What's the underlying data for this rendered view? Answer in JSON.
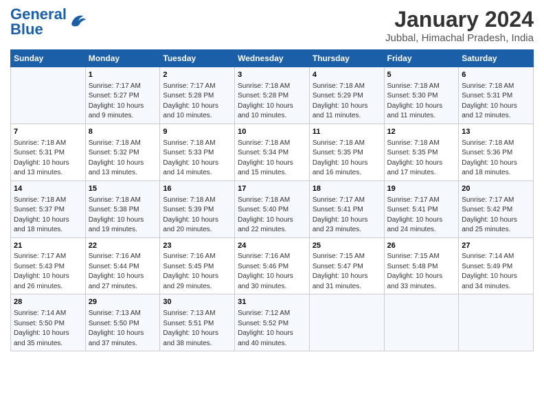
{
  "header": {
    "logo_general": "General",
    "logo_blue": "Blue",
    "month": "January 2024",
    "location": "Jubbal, Himachal Pradesh, India"
  },
  "weekdays": [
    "Sunday",
    "Monday",
    "Tuesday",
    "Wednesday",
    "Thursday",
    "Friday",
    "Saturday"
  ],
  "weeks": [
    [
      {
        "day": "",
        "sunrise": "",
        "sunset": "",
        "daylight": ""
      },
      {
        "day": "1",
        "sunrise": "Sunrise: 7:17 AM",
        "sunset": "Sunset: 5:27 PM",
        "daylight": "Daylight: 10 hours and 9 minutes."
      },
      {
        "day": "2",
        "sunrise": "Sunrise: 7:17 AM",
        "sunset": "Sunset: 5:28 PM",
        "daylight": "Daylight: 10 hours and 10 minutes."
      },
      {
        "day": "3",
        "sunrise": "Sunrise: 7:18 AM",
        "sunset": "Sunset: 5:28 PM",
        "daylight": "Daylight: 10 hours and 10 minutes."
      },
      {
        "day": "4",
        "sunrise": "Sunrise: 7:18 AM",
        "sunset": "Sunset: 5:29 PM",
        "daylight": "Daylight: 10 hours and 11 minutes."
      },
      {
        "day": "5",
        "sunrise": "Sunrise: 7:18 AM",
        "sunset": "Sunset: 5:30 PM",
        "daylight": "Daylight: 10 hours and 11 minutes."
      },
      {
        "day": "6",
        "sunrise": "Sunrise: 7:18 AM",
        "sunset": "Sunset: 5:31 PM",
        "daylight": "Daylight: 10 hours and 12 minutes."
      }
    ],
    [
      {
        "day": "7",
        "sunrise": "Sunrise: 7:18 AM",
        "sunset": "Sunset: 5:31 PM",
        "daylight": "Daylight: 10 hours and 13 minutes."
      },
      {
        "day": "8",
        "sunrise": "Sunrise: 7:18 AM",
        "sunset": "Sunset: 5:32 PM",
        "daylight": "Daylight: 10 hours and 13 minutes."
      },
      {
        "day": "9",
        "sunrise": "Sunrise: 7:18 AM",
        "sunset": "Sunset: 5:33 PM",
        "daylight": "Daylight: 10 hours and 14 minutes."
      },
      {
        "day": "10",
        "sunrise": "Sunrise: 7:18 AM",
        "sunset": "Sunset: 5:34 PM",
        "daylight": "Daylight: 10 hours and 15 minutes."
      },
      {
        "day": "11",
        "sunrise": "Sunrise: 7:18 AM",
        "sunset": "Sunset: 5:35 PM",
        "daylight": "Daylight: 10 hours and 16 minutes."
      },
      {
        "day": "12",
        "sunrise": "Sunrise: 7:18 AM",
        "sunset": "Sunset: 5:35 PM",
        "daylight": "Daylight: 10 hours and 17 minutes."
      },
      {
        "day": "13",
        "sunrise": "Sunrise: 7:18 AM",
        "sunset": "Sunset: 5:36 PM",
        "daylight": "Daylight: 10 hours and 18 minutes."
      }
    ],
    [
      {
        "day": "14",
        "sunrise": "Sunrise: 7:18 AM",
        "sunset": "Sunset: 5:37 PM",
        "daylight": "Daylight: 10 hours and 18 minutes."
      },
      {
        "day": "15",
        "sunrise": "Sunrise: 7:18 AM",
        "sunset": "Sunset: 5:38 PM",
        "daylight": "Daylight: 10 hours and 19 minutes."
      },
      {
        "day": "16",
        "sunrise": "Sunrise: 7:18 AM",
        "sunset": "Sunset: 5:39 PM",
        "daylight": "Daylight: 10 hours and 20 minutes."
      },
      {
        "day": "17",
        "sunrise": "Sunrise: 7:18 AM",
        "sunset": "Sunset: 5:40 PM",
        "daylight": "Daylight: 10 hours and 22 minutes."
      },
      {
        "day": "18",
        "sunrise": "Sunrise: 7:17 AM",
        "sunset": "Sunset: 5:41 PM",
        "daylight": "Daylight: 10 hours and 23 minutes."
      },
      {
        "day": "19",
        "sunrise": "Sunrise: 7:17 AM",
        "sunset": "Sunset: 5:41 PM",
        "daylight": "Daylight: 10 hours and 24 minutes."
      },
      {
        "day": "20",
        "sunrise": "Sunrise: 7:17 AM",
        "sunset": "Sunset: 5:42 PM",
        "daylight": "Daylight: 10 hours and 25 minutes."
      }
    ],
    [
      {
        "day": "21",
        "sunrise": "Sunrise: 7:17 AM",
        "sunset": "Sunset: 5:43 PM",
        "daylight": "Daylight: 10 hours and 26 minutes."
      },
      {
        "day": "22",
        "sunrise": "Sunrise: 7:16 AM",
        "sunset": "Sunset: 5:44 PM",
        "daylight": "Daylight: 10 hours and 27 minutes."
      },
      {
        "day": "23",
        "sunrise": "Sunrise: 7:16 AM",
        "sunset": "Sunset: 5:45 PM",
        "daylight": "Daylight: 10 hours and 29 minutes."
      },
      {
        "day": "24",
        "sunrise": "Sunrise: 7:16 AM",
        "sunset": "Sunset: 5:46 PM",
        "daylight": "Daylight: 10 hours and 30 minutes."
      },
      {
        "day": "25",
        "sunrise": "Sunrise: 7:15 AM",
        "sunset": "Sunset: 5:47 PM",
        "daylight": "Daylight: 10 hours and 31 minutes."
      },
      {
        "day": "26",
        "sunrise": "Sunrise: 7:15 AM",
        "sunset": "Sunset: 5:48 PM",
        "daylight": "Daylight: 10 hours and 33 minutes."
      },
      {
        "day": "27",
        "sunrise": "Sunrise: 7:14 AM",
        "sunset": "Sunset: 5:49 PM",
        "daylight": "Daylight: 10 hours and 34 minutes."
      }
    ],
    [
      {
        "day": "28",
        "sunrise": "Sunrise: 7:14 AM",
        "sunset": "Sunset: 5:50 PM",
        "daylight": "Daylight: 10 hours and 35 minutes."
      },
      {
        "day": "29",
        "sunrise": "Sunrise: 7:13 AM",
        "sunset": "Sunset: 5:50 PM",
        "daylight": "Daylight: 10 hours and 37 minutes."
      },
      {
        "day": "30",
        "sunrise": "Sunrise: 7:13 AM",
        "sunset": "Sunset: 5:51 PM",
        "daylight": "Daylight: 10 hours and 38 minutes."
      },
      {
        "day": "31",
        "sunrise": "Sunrise: 7:12 AM",
        "sunset": "Sunset: 5:52 PM",
        "daylight": "Daylight: 10 hours and 40 minutes."
      },
      {
        "day": "",
        "sunrise": "",
        "sunset": "",
        "daylight": ""
      },
      {
        "day": "",
        "sunrise": "",
        "sunset": "",
        "daylight": ""
      },
      {
        "day": "",
        "sunrise": "",
        "sunset": "",
        "daylight": ""
      }
    ]
  ]
}
